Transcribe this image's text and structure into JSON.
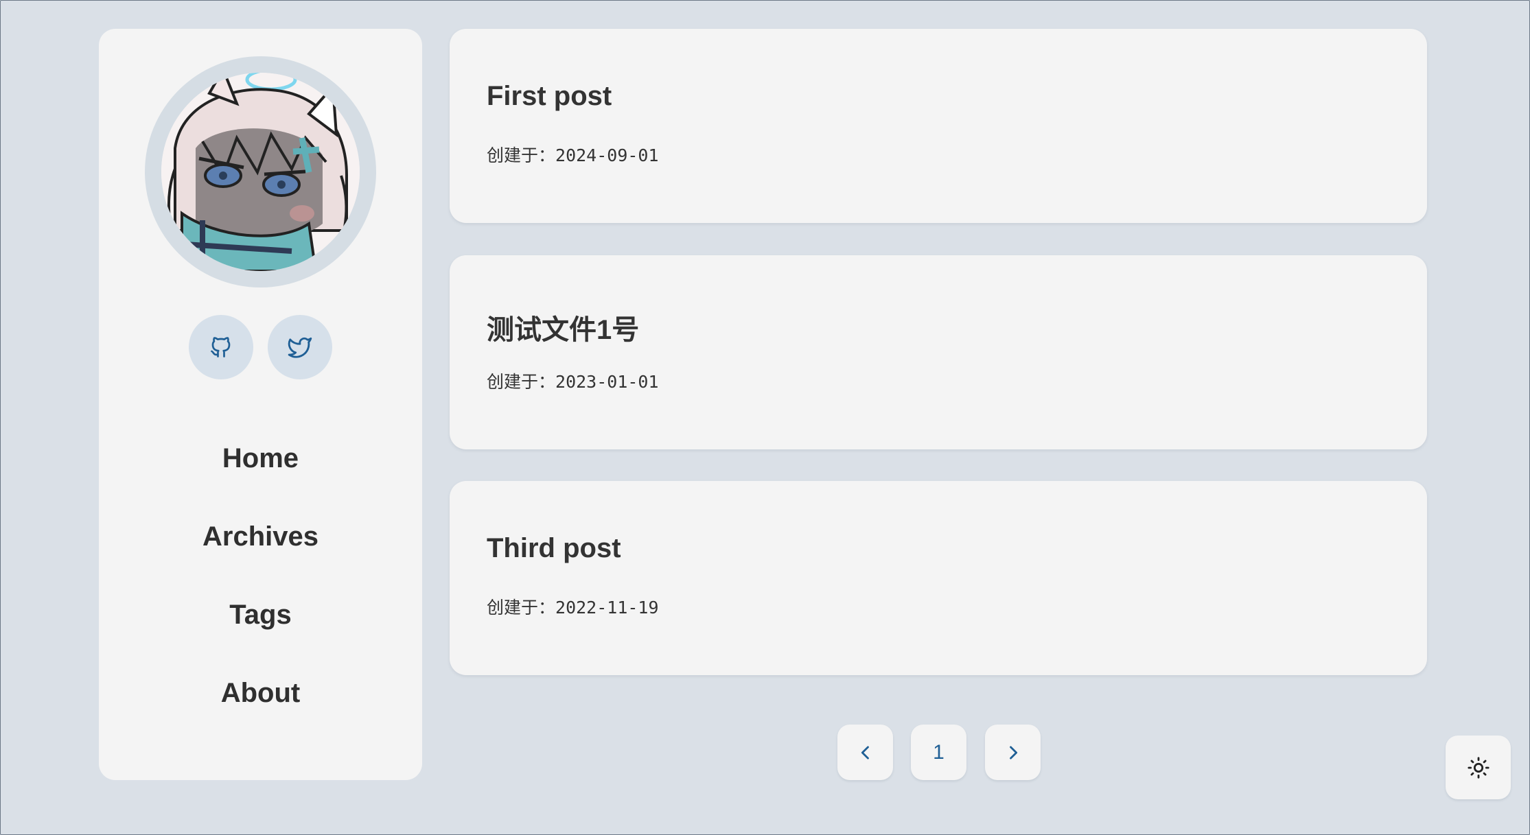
{
  "sidebar": {
    "nav": [
      {
        "label": "Home"
      },
      {
        "label": "Archives"
      },
      {
        "label": "Tags"
      },
      {
        "label": "About"
      }
    ],
    "social": [
      "github-icon",
      "twitter-icon"
    ]
  },
  "posts": [
    {
      "title": "First post",
      "meta_label": "创建于：",
      "date": "2024-09-01"
    },
    {
      "title": "测试文件1号",
      "meta_label": "创建于：",
      "date": "2023-01-01"
    },
    {
      "title": "Third post",
      "meta_label": "创建于：",
      "date": "2022-11-19"
    }
  ],
  "pagination": {
    "current_page": "1"
  },
  "colors": {
    "background": "#dae0e7",
    "card": "#f4f4f4",
    "accent": "#1f5f95",
    "social_bg": "#d6e0ea"
  }
}
